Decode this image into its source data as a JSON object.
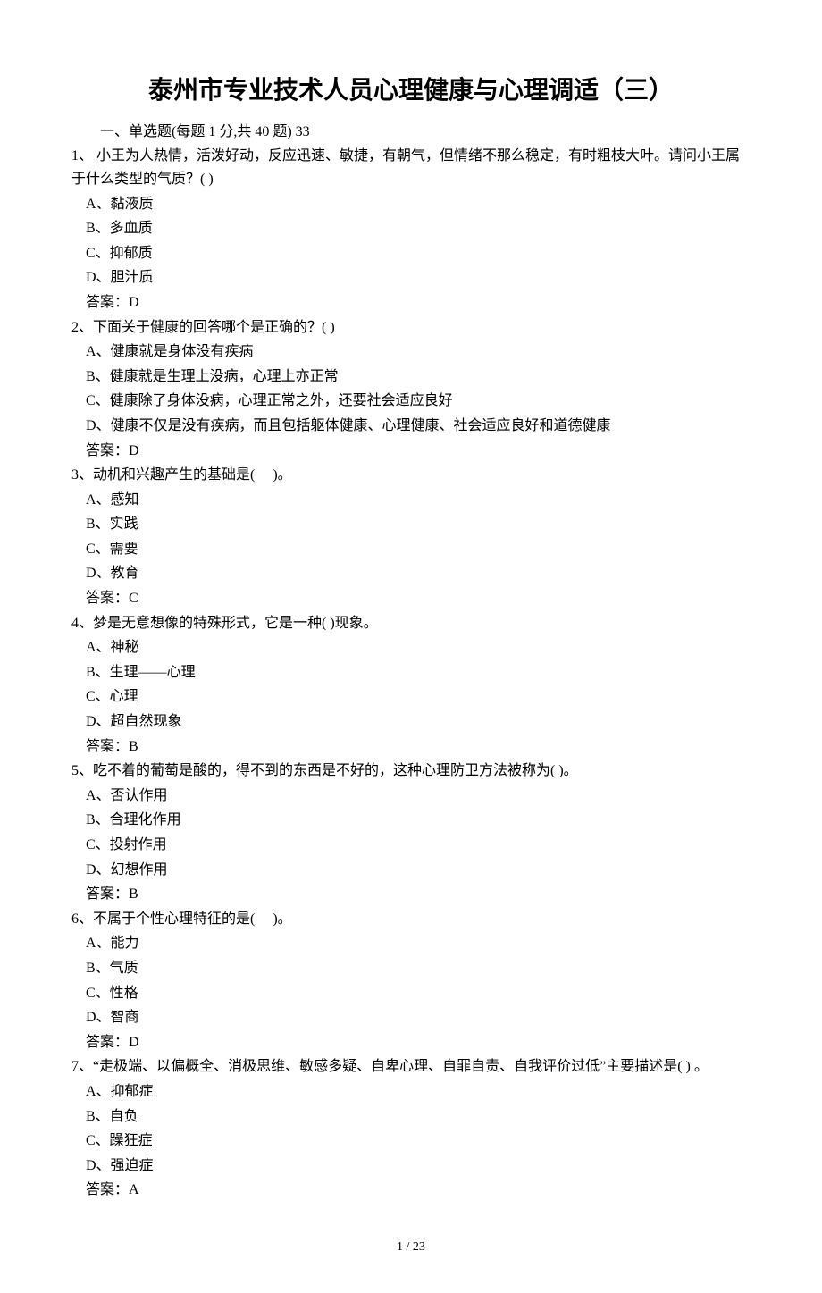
{
  "title": "泰州市专业技术人员心理健康与心理调适（三）",
  "section_header": "一、单选题(每题 1 分,共 40 题) 33",
  "questions": [
    {
      "num": "1、",
      "text": " 小王为人热情，活泼好动，反应迅速、敏捷，有朝气，但情绪不那么稳定，有时粗枝大叶。请问小王属于什么类型的气质？(  )",
      "options": [
        "A、黏液质",
        "B、多血质",
        "C、抑郁质",
        "D、胆汁质"
      ],
      "answer": "答案：D"
    },
    {
      "num": "2、",
      "text": "下面关于健康的回答哪个是正确的？(  )",
      "options": [
        "A、健康就是身体没有疾病",
        "B、健康就是生理上没病，心理上亦正常",
        "C、健康除了身体没病，心理正常之外，还要社会适应良好",
        "D、健康不仅是没有疾病，而且包括躯体健康、心理健康、社会适应良好和道德健康"
      ],
      "answer": "答案：D"
    },
    {
      "num": "3、",
      "text": "动机和兴趣产生的基础是(　 )。",
      "options": [
        "A、感知",
        "B、实践",
        "C、需要",
        "D、教育"
      ],
      "answer": "答案：C"
    },
    {
      "num": "4、",
      "text": "梦是无意想像的特殊形式，它是一种(   )现象。",
      "options": [
        "A、神秘",
        "B、生理——心理",
        "C、心理",
        "D、超自然现象"
      ],
      "answer": "答案：B"
    },
    {
      "num": "5、",
      "text": "吃不着的葡萄是酸的，得不到的东西是不好的，这种心理防卫方法被称为(   )。",
      "options": [
        "A、否认作用",
        "B、合理化作用",
        "C、投射作用",
        "D、幻想作用"
      ],
      "answer": "答案：B"
    },
    {
      "num": "6、",
      "text": "不属于个性心理特征的是(　 )。",
      "options": [
        "A、能力",
        "B、气质",
        "C、性格",
        "D、智商"
      ],
      "answer": "答案：D"
    },
    {
      "num": "7、",
      "text": "“走极端、以偏概全、消极思维、敏感多疑、自卑心理、自罪自责、自我评价过低”主要描述是(   ) 。",
      "options": [
        "A、抑郁症",
        "B、自负",
        "C、躁狂症",
        "D、强迫症"
      ],
      "answer": "答案：A"
    }
  ],
  "footer": "1  / 23"
}
